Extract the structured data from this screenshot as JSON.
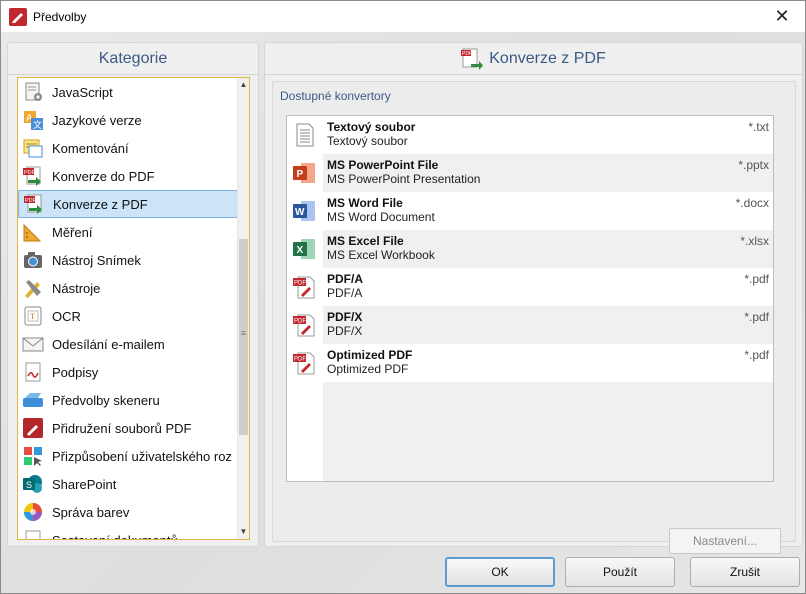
{
  "window": {
    "title": "Předvolby",
    "close_glyph": "✕"
  },
  "left_panel": {
    "header": "Kategorie",
    "items": [
      {
        "label": "JavaScript",
        "icon": "script-gear-icon"
      },
      {
        "label": "Jazykové verze",
        "icon": "language-icon"
      },
      {
        "label": "Komentování",
        "icon": "comment-icon"
      },
      {
        "label": "Konverze do PDF",
        "icon": "convert-to-pdf-icon"
      },
      {
        "label": "Konverze z PDF",
        "icon": "convert-from-pdf-icon",
        "selected": true
      },
      {
        "label": "Měření",
        "icon": "ruler-icon"
      },
      {
        "label": "Nástroj Snímek",
        "icon": "camera-icon"
      },
      {
        "label": "Nástroje",
        "icon": "tools-icon"
      },
      {
        "label": "OCR",
        "icon": "ocr-icon"
      },
      {
        "label": "Odesílání e-mailem",
        "icon": "envelope-icon"
      },
      {
        "label": "Podpisy",
        "icon": "signature-icon"
      },
      {
        "label": "Předvolby skeneru",
        "icon": "scanner-icon"
      },
      {
        "label": "Přidružení souborů PDF",
        "icon": "pdf-association-icon"
      },
      {
        "label": "Přizpůsobení uživatelského roz",
        "icon": "customize-icon"
      },
      {
        "label": "SharePoint",
        "icon": "sharepoint-icon"
      },
      {
        "label": "Správa barev",
        "icon": "color-wheel-icon"
      },
      {
        "label": "Sestavení dokumentů",
        "icon": "document-icon"
      }
    ]
  },
  "right_panel": {
    "header": "Konverze z PDF",
    "group_title": "Dostupné konvertory",
    "converters": [
      {
        "name": "Textový soubor",
        "desc": "Textový soubor",
        "ext": "*.txt",
        "icon": "text-file-icon"
      },
      {
        "name": "MS PowerPoint File",
        "desc": "MS PowerPoint Presentation",
        "ext": "*.pptx",
        "icon": "powerpoint-icon"
      },
      {
        "name": "MS Word File",
        "desc": "MS Word Document",
        "ext": "*.docx",
        "icon": "word-icon"
      },
      {
        "name": "MS Excel File",
        "desc": "MS Excel Workbook",
        "ext": "*.xlsx",
        "icon": "excel-icon"
      },
      {
        "name": "PDF/A",
        "desc": "PDF/A",
        "ext": "*.pdf",
        "icon": "pdf-icon"
      },
      {
        "name": "PDF/X",
        "desc": "PDF/X",
        "ext": "*.pdf",
        "icon": "pdf-icon"
      },
      {
        "name": "Optimized PDF",
        "desc": "Optimized PDF",
        "ext": "*.pdf",
        "icon": "pdf-icon"
      }
    ],
    "settings_button": "Nastavení..."
  },
  "buttons": {
    "ok": "OK",
    "apply": "Použít",
    "cancel": "Zrušit"
  },
  "colors": {
    "accent": "#3a5a85",
    "selection": "#cce4f7",
    "list_border": "#e0b64a"
  }
}
